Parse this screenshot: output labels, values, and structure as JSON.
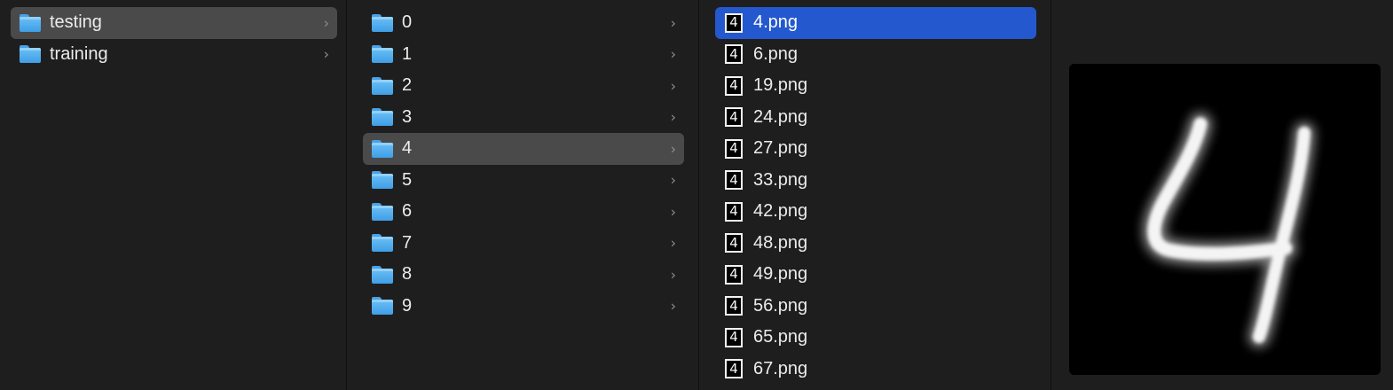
{
  "columns": {
    "root": {
      "items": [
        {
          "label": "testing",
          "icon": "folder-icon",
          "selected": true
        },
        {
          "label": "training",
          "icon": "folder-icon",
          "selected": false
        }
      ]
    },
    "digits": {
      "items": [
        {
          "label": "0",
          "icon": "folder-icon"
        },
        {
          "label": "1",
          "icon": "folder-icon"
        },
        {
          "label": "2",
          "icon": "folder-icon"
        },
        {
          "label": "3",
          "icon": "folder-icon"
        },
        {
          "label": "4",
          "icon": "folder-icon",
          "selected": true
        },
        {
          "label": "5",
          "icon": "folder-icon"
        },
        {
          "label": "6",
          "icon": "folder-icon"
        },
        {
          "label": "7",
          "icon": "folder-icon"
        },
        {
          "label": "8",
          "icon": "folder-icon"
        },
        {
          "label": "9",
          "icon": "folder-icon"
        }
      ]
    },
    "files": {
      "items": [
        {
          "label": "4.png",
          "icon": "image-file-icon",
          "selected": true
        },
        {
          "label": "6.png",
          "icon": "image-file-icon"
        },
        {
          "label": "19.png",
          "icon": "image-file-icon"
        },
        {
          "label": "24.png",
          "icon": "image-file-icon"
        },
        {
          "label": "27.png",
          "icon": "image-file-icon"
        },
        {
          "label": "33.png",
          "icon": "image-file-icon"
        },
        {
          "label": "42.png",
          "icon": "image-file-icon"
        },
        {
          "label": "48.png",
          "icon": "image-file-icon"
        },
        {
          "label": "49.png",
          "icon": "image-file-icon"
        },
        {
          "label": "56.png",
          "icon": "image-file-icon"
        },
        {
          "label": "65.png",
          "icon": "image-file-icon"
        },
        {
          "label": "67.png",
          "icon": "image-file-icon"
        }
      ]
    }
  },
  "preview": {
    "image": "handwritten-digit-4-preview"
  },
  "colors": {
    "background": "#1e1e1e",
    "selection_gray": "#4a4a4a",
    "selection_blue": "#2458cf",
    "folder_blue": "#4aa0e4",
    "text": "#ececec",
    "chevron": "#8f8f8f"
  }
}
